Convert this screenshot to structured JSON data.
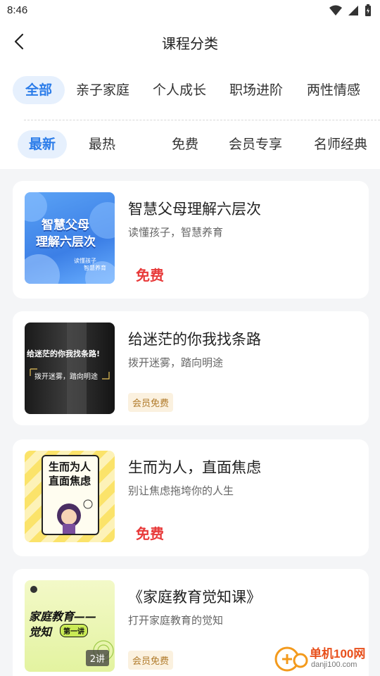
{
  "status_bar": {
    "time": "8:46"
  },
  "header": {
    "title": "课程分类"
  },
  "category_tabs": [
    {
      "label": "全部"
    },
    {
      "label": "亲子家庭"
    },
    {
      "label": "个人成长"
    },
    {
      "label": "职场进阶"
    },
    {
      "label": "两性情感"
    }
  ],
  "filter_tabs": [
    {
      "label": "最新"
    },
    {
      "label": "最热"
    },
    {
      "label": "免费"
    },
    {
      "label": "会员专享"
    },
    {
      "label": "名师经典"
    }
  ],
  "courses": [
    {
      "title": "智慧父母理解六层次",
      "subtitle": "读懂孩子，智慧养育",
      "price_tag": "免费",
      "thumb_lines": [
        "智慧父母",
        "理解六层次"
      ],
      "thumb_small": [
        "读懂孩子",
        "智慧养育"
      ]
    },
    {
      "title": "给迷茫的你我找条路",
      "subtitle": "拨开迷雾，踏向明途",
      "price_tag": "会员免费",
      "thumb_lines": [
        "给迷茫的你我找条路!",
        "拨开迷雾，踏向明途"
      ]
    },
    {
      "title": "生而为人，直面焦虑",
      "subtitle": "别让焦虑拖垮你的人生",
      "price_tag": "免费",
      "thumb_lines": [
        "生而为人",
        "直面焦虑"
      ]
    },
    {
      "title": "《家庭教育觉知课》",
      "subtitle": "打开家庭教育的觉知",
      "price_tag": "会员免费",
      "thumb_lines": [
        "家庭教育——",
        "觉知",
        "第一讲"
      ],
      "lesson_count": "2讲"
    }
  ],
  "watermark": {
    "name": "单机100网",
    "url": "danji100.com"
  },
  "colors": {
    "accent": "#2b7ce9",
    "free": "#e83a3a",
    "vip_text": "#b07a2a",
    "vip_bg": "#fbf1df"
  }
}
